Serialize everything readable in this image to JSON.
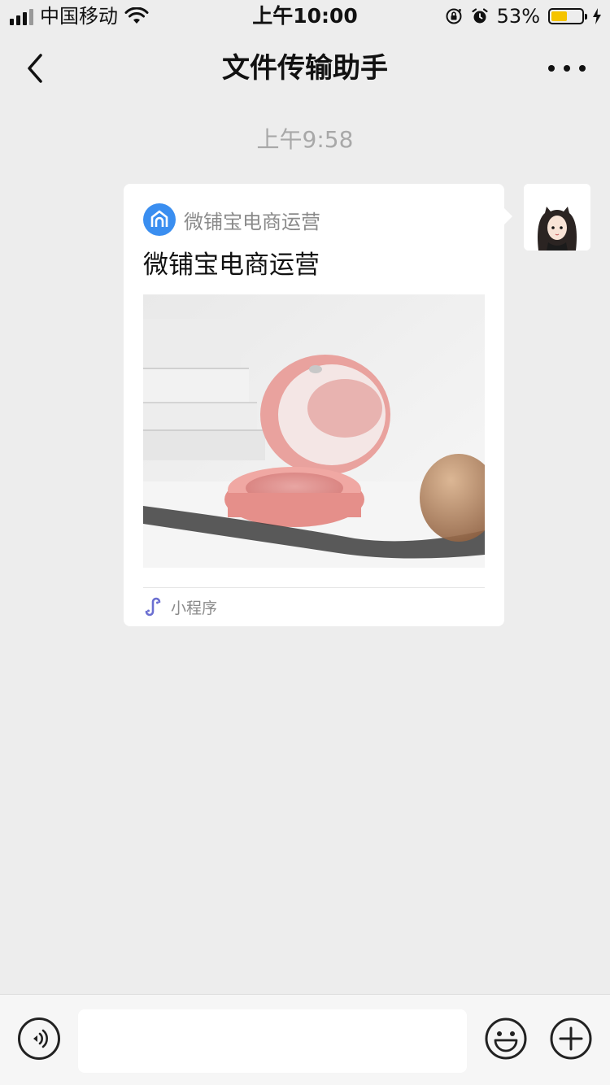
{
  "status_bar": {
    "carrier": "中国移动",
    "time": "上午10:00",
    "battery_percent": "53%",
    "battery_level": 0.53,
    "icons": [
      "signal-icon",
      "wifi-icon",
      "orientation-lock-icon",
      "alarm-icon",
      "battery-icon",
      "charging-icon"
    ]
  },
  "nav": {
    "title": "文件传输助手",
    "back_icon": "chevron-left-icon",
    "more_icon": "more-dots-icon"
  },
  "chat": {
    "timestamp": "上午9:58",
    "message": {
      "mini_program_name": "微铺宝电商运营",
      "title": "微铺宝电商运营",
      "image_desc_icon": "product-image",
      "footer_label": "小程序"
    }
  },
  "input_bar": {
    "placeholder": "",
    "icons": [
      "voice-icon",
      "emoji-icon",
      "plus-icon"
    ]
  },
  "colors": {
    "background": "#ededed",
    "mini_program_blue": "#3a8ef0",
    "mini_program_link": "#6b6fd1",
    "battery_fill": "#f5c400"
  }
}
